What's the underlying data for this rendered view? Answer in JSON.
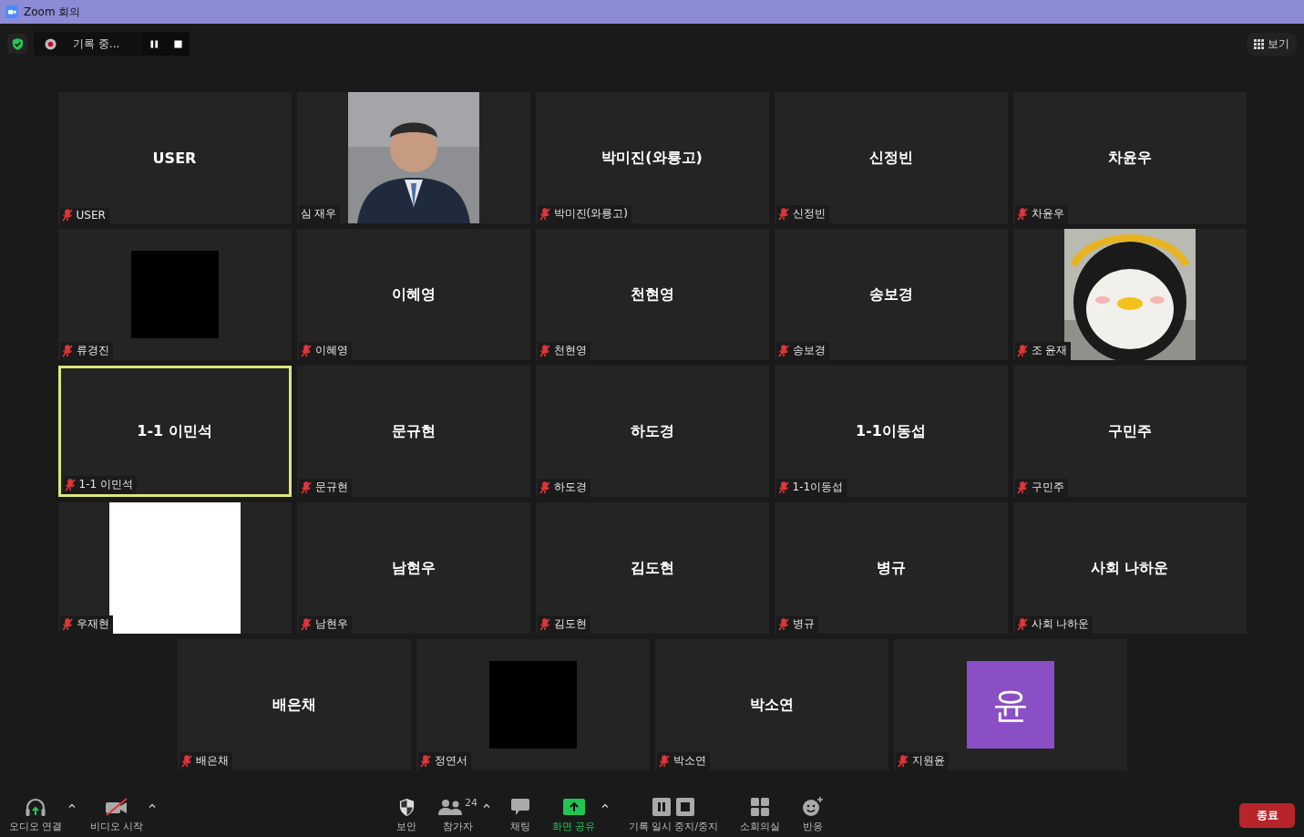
{
  "window": {
    "title": "Zoom 회의"
  },
  "top_bar": {
    "recording_label": "기록 중...",
    "view_button": "보기"
  },
  "tiles": [
    {
      "kind": "name",
      "display_name": "USER",
      "name": "USER",
      "muted": true,
      "active": false
    },
    {
      "name": "심 재우",
      "muted": false,
      "active": false
    },
    {
      "kind": "name",
      "display_name": "박미진(와룡고)",
      "name": "박미진(와룡고)",
      "muted": true,
      "active": false
    },
    {
      "kind": "name",
      "display_name": "신정빈",
      "name": "신정빈",
      "muted": true,
      "active": false
    },
    {
      "kind": "name",
      "display_name": "차윤우",
      "name": "차윤우",
      "muted": true,
      "active": false
    },
    {
      "kind": "black",
      "name": "류경진",
      "muted": true,
      "active": false
    },
    {
      "kind": "name",
      "display_name": "이혜영",
      "name": "이혜영",
      "muted": true,
      "active": false
    },
    {
      "kind": "name",
      "display_name": "천현영",
      "name": "천현영",
      "muted": true,
      "active": false
    },
    {
      "kind": "name",
      "display_name": "송보경",
      "name": "송보경",
      "muted": true,
      "active": false
    },
    {
      "name": "조 윤재",
      "muted": true,
      "active": false
    },
    {
      "kind": "name",
      "display_name": "1-1 이민석",
      "name": "1-1 이민석",
      "muted": true,
      "active": true
    },
    {
      "kind": "name",
      "display_name": "문규현",
      "name": "문규현",
      "muted": true,
      "active": false
    },
    {
      "kind": "name",
      "display_name": "하도경",
      "name": "하도경",
      "muted": true,
      "active": false
    },
    {
      "kind": "name",
      "display_name": "1-1이동섭",
      "name": "1-1이동섭",
      "muted": true,
      "active": false
    },
    {
      "kind": "name",
      "display_name": "구민주",
      "name": "구민주",
      "muted": true,
      "active": false
    },
    {
      "kind": "white",
      "name": "우재현",
      "muted": true,
      "active": false
    },
    {
      "kind": "name",
      "display_name": "남현우",
      "name": "남현우",
      "muted": true,
      "active": false
    },
    {
      "kind": "name",
      "display_name": "김도현",
      "name": "김도현",
      "muted": true,
      "active": false
    },
    {
      "kind": "name",
      "display_name": "병규",
      "name": "병규",
      "muted": true,
      "active": false
    },
    {
      "kind": "name",
      "display_name": "사회 나하운",
      "name": "사회 나하운",
      "muted": true,
      "active": false
    },
    {
      "kind": "name",
      "display_name": "배은채",
      "name": "배은채",
      "muted": true,
      "active": false
    },
    {
      "kind": "black",
      "name": "정연서",
      "muted": true,
      "active": false
    },
    {
      "kind": "name",
      "display_name": "박소연",
      "name": "박소연",
      "muted": true,
      "active": false
    },
    {
      "kind": "avatar",
      "initial": "윤",
      "name": "지원윤",
      "muted": true,
      "active": false
    }
  ],
  "toolbar": {
    "items": [
      {
        "kind": "audio",
        "label": "오디오 연결",
        "caret": true
      },
      {
        "kind": "video",
        "label": "비디오 시작",
        "caret": true
      },
      {
        "kind": "security",
        "label": "보안",
        "caret": false
      },
      {
        "kind": "participants",
        "label": "참가자",
        "count": "24",
        "caret": true
      },
      {
        "kind": "chat",
        "label": "채팅",
        "caret": false
      },
      {
        "kind": "share",
        "label": "화면 공유",
        "caret": true
      },
      {
        "kind": "record",
        "label": "기록 일시 중지/중지",
        "caret": false
      },
      {
        "kind": "breakout",
        "label": "소회의실",
        "caret": false
      },
      {
        "kind": "reactions",
        "label": "반응",
        "caret": false
      }
    ],
    "end_button": "종료"
  }
}
